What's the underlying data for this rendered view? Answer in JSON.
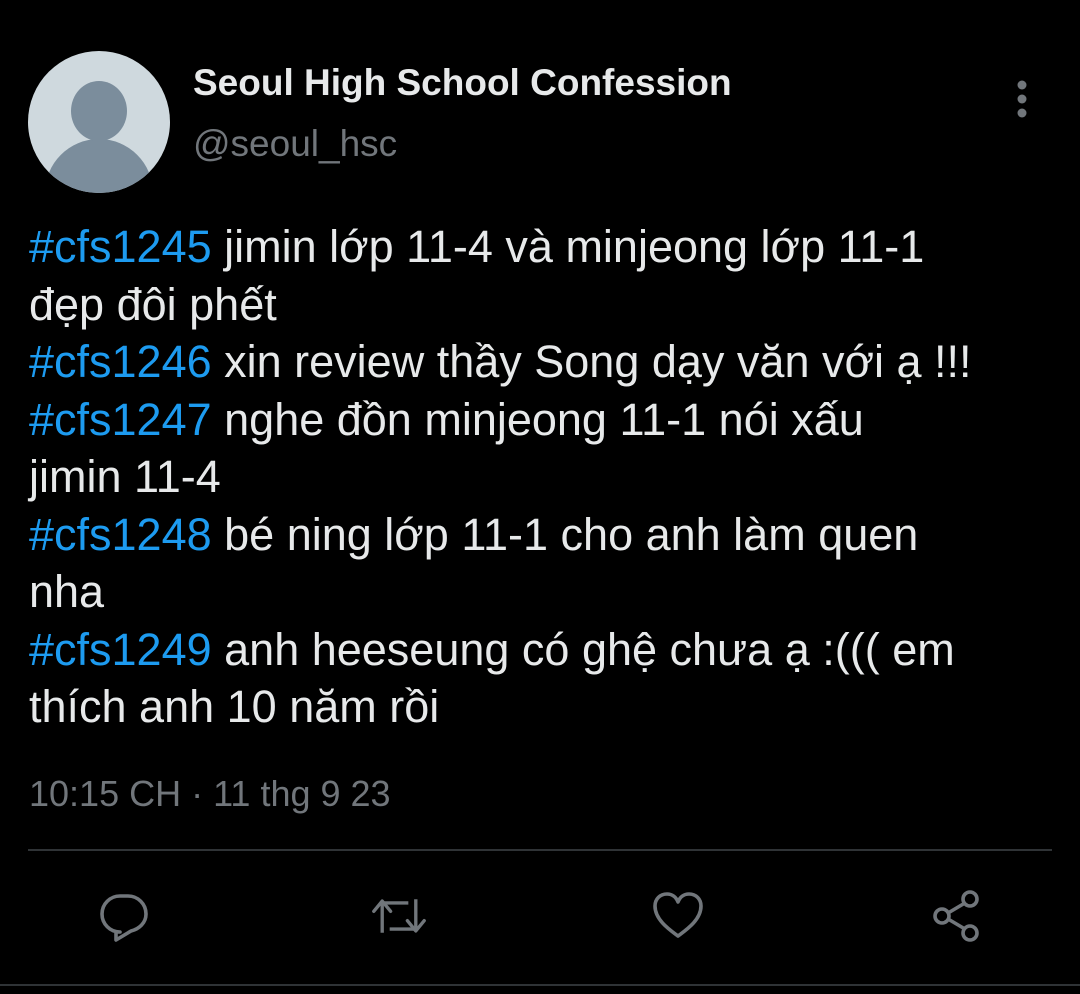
{
  "account": {
    "display_name": "Seoul High School Confession",
    "handle": "@seoul_hsc"
  },
  "tweet": {
    "lines": [
      {
        "tag": "#cfs1245",
        "text": " jimin lớp 11-4 và minjeong lớp 11-1"
      },
      {
        "tag": "",
        "text": "đẹp đôi phết"
      },
      {
        "tag": "#cfs1246",
        "text": " xin review thầy Song dạy văn với ạ !!!"
      },
      {
        "tag": "#cfs1247",
        "text": " nghe đồn minjeong 11-1 nói xấu"
      },
      {
        "tag": "",
        "text": "jimin 11-4"
      },
      {
        "tag": "#cfs1248",
        "text": " bé ning lớp 11-1 cho anh làm quen"
      },
      {
        "tag": "",
        "text": "nha"
      },
      {
        "tag": "#cfs1249",
        "text": " anh heeseung có ghệ chưa ạ :((( em"
      },
      {
        "tag": "",
        "text": "thích anh 10 năm rồi"
      }
    ],
    "timestamp": "10:15 CH · 11 thg 9 23"
  },
  "actions": [
    {
      "name": "reply-button",
      "icon": "reply-icon"
    },
    {
      "name": "retweet-button",
      "icon": "retweet-icon"
    },
    {
      "name": "like-button",
      "icon": "heart-icon"
    },
    {
      "name": "share-button",
      "icon": "share-icon"
    }
  ],
  "colors": {
    "background": "#000000",
    "text": "#e7e9ea",
    "secondary": "#71767b",
    "hashtag": "#1d9bf0",
    "avatar_bg": "#cfd9de",
    "avatar_fg": "#7b8d9c",
    "divider": "#2f3336"
  }
}
